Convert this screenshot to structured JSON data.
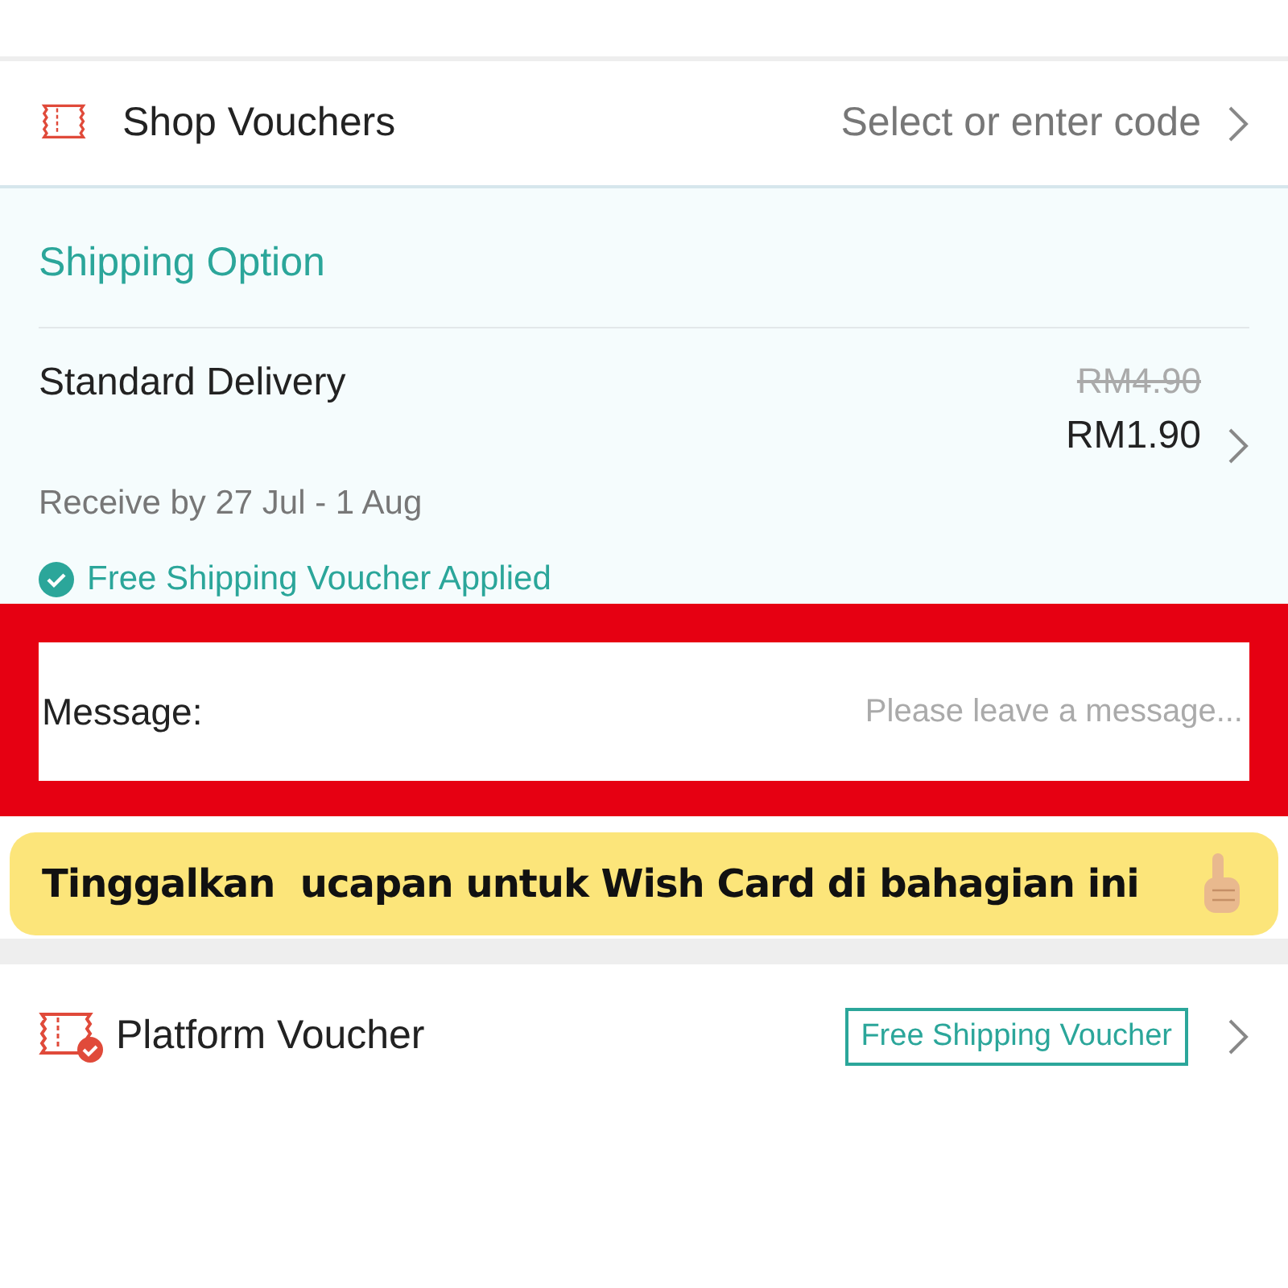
{
  "shop_vouchers": {
    "label": "Shop Vouchers",
    "hint": "Select or enter code"
  },
  "shipping": {
    "title": "Shipping Option",
    "method": "Standard Delivery",
    "original_price": "RM4.90",
    "price": "RM1.90",
    "eta": "Receive by 27 Jul - 1 Aug",
    "voucher_note": "Free Shipping Voucher Applied"
  },
  "message": {
    "label": "Message:",
    "placeholder": "Please leave a message..."
  },
  "banner": {
    "text": "Tinggalkan  ucapan untuk Wish Card di bahagian ini"
  },
  "platform_voucher": {
    "label": "Platform Voucher",
    "tag": "Free Shipping Voucher"
  }
}
